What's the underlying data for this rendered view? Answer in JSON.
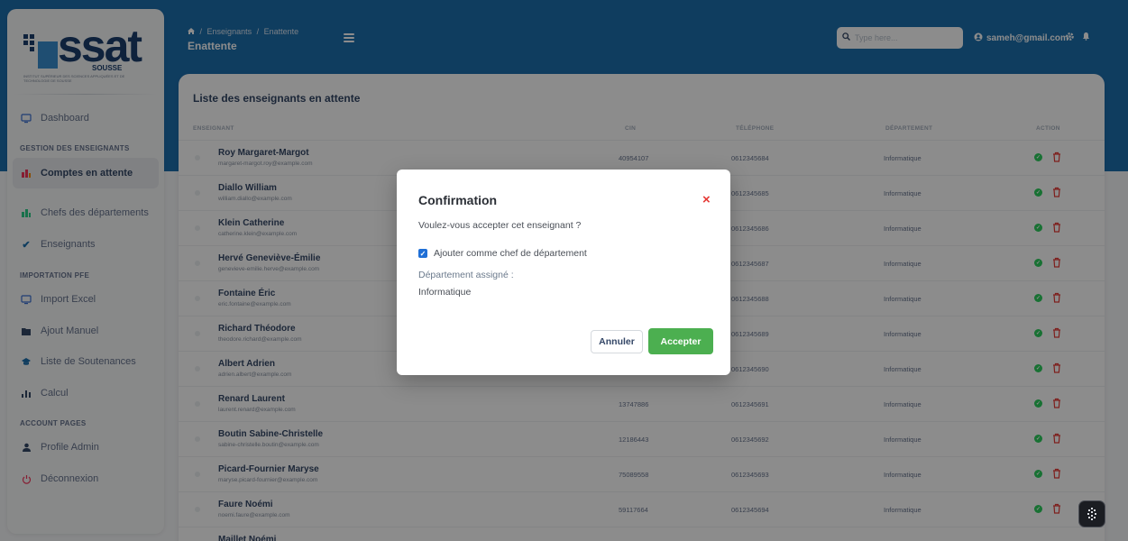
{
  "logo": {
    "word": "ssat",
    "sub": "SOUSSE",
    "tagline": "INSTITUT SUPÉRIEUR DES SCIENCES APPLIQUÉES ET DE TECHNOLOGIE DE SOUSSE"
  },
  "sidebar": {
    "dashboard": "Dashboard",
    "section_gestion": "GESTION DES ENSEIGNANTS",
    "comptes": "Comptes en attente",
    "chefs": "Chefs des départements",
    "enseignants": "Enseignants",
    "section_import": "IMPORTATION PFE",
    "import_excel": "Import Excel",
    "ajout_manuel": "Ajout Manuel",
    "soutenances": "Liste de Soutenances",
    "calcul": "Calcul",
    "section_account": "ACCOUNT PAGES",
    "profile": "Profile Admin",
    "logout": "Déconnexion"
  },
  "header": {
    "crumb_1": "Enseignants",
    "crumb_2": "Enattente",
    "crumb_sep": "/",
    "title": "Enattente",
    "search_placeholder": "Type here...",
    "user_email": "sameh@gmail.com"
  },
  "table": {
    "title": "Liste des enseignants en attente",
    "headers": {
      "enseignant": "ENSEIGNANT",
      "cin": "CIN",
      "telephone": "TÉLÉPHONE",
      "departement": "DÉPARTEMENT",
      "action": "ACTION"
    },
    "rows": [
      {
        "name": "Roy Margaret-Margot",
        "email": "margaret-margot.roy@example.com",
        "cin": "40954107",
        "tel": "0612345684",
        "dep": "Informatique"
      },
      {
        "name": "Diallo William",
        "email": "william.diallo@example.com",
        "cin": "",
        "tel": "0612345685",
        "dep": "Informatique"
      },
      {
        "name": "Klein Catherine",
        "email": "catherine.klein@example.com",
        "cin": "",
        "tel": "0612345686",
        "dep": "Informatique"
      },
      {
        "name": "Hervé Geneviève-Émilie",
        "email": "genevieve-emilie.herve@example.com",
        "cin": "",
        "tel": "0612345687",
        "dep": "Informatique"
      },
      {
        "name": "Fontaine Éric",
        "email": "eric.fontaine@example.com",
        "cin": "",
        "tel": "0612345688",
        "dep": "Informatique"
      },
      {
        "name": "Richard Théodore",
        "email": "theodore.richard@example.com",
        "cin": "",
        "tel": "0612345689",
        "dep": "Informatique"
      },
      {
        "name": "Albert Adrien",
        "email": "adrien.albert@example.com",
        "cin": "",
        "tel": "0612345690",
        "dep": "Informatique"
      },
      {
        "name": "Renard Laurent",
        "email": "laurent.renard@example.com",
        "cin": "13747886",
        "tel": "0612345691",
        "dep": "Informatique"
      },
      {
        "name": "Boutin Sabine-Christelle",
        "email": "sabine-christelle.boutin@example.com",
        "cin": "12186443",
        "tel": "0612345692",
        "dep": "Informatique"
      },
      {
        "name": "Picard-Fournier Maryse",
        "email": "maryse.picard-fournier@example.com",
        "cin": "75089558",
        "tel": "0612345693",
        "dep": "Informatique"
      },
      {
        "name": "Faure Noémi",
        "email": "noemi.faure@example.com",
        "cin": "59117664",
        "tel": "0612345694",
        "dep": "Informatique"
      },
      {
        "name": "Maillet Noémi",
        "email": "",
        "cin": "",
        "tel": "",
        "dep": ""
      }
    ]
  },
  "modal": {
    "title": "Confirmation",
    "close": "×",
    "question": "Voulez-vous accepter cet enseignant ?",
    "checkbox_label": "Ajouter comme chef de département",
    "checkbox_checked": true,
    "dep_label": "Département assigné :",
    "dep_value": "Informatique",
    "cancel": "Annuler",
    "accept": "Accepter"
  },
  "colors": {
    "primary_band": "#1d6fae",
    "accept": "#4caf50",
    "close": "#e53935",
    "approve_dot": "#2dce5e",
    "delete": "#e53935"
  }
}
